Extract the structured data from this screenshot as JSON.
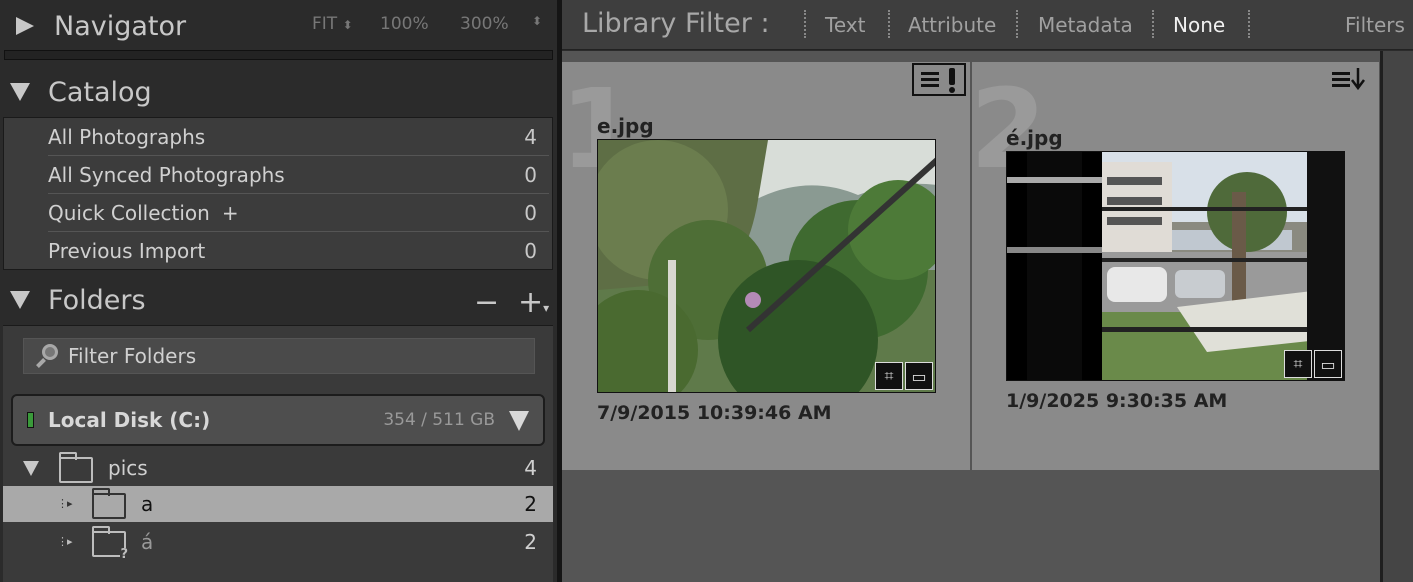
{
  "navigator": {
    "title": "Navigator",
    "zoom_options": [
      "FIT",
      "100%",
      "300%"
    ]
  },
  "catalog": {
    "title": "Catalog",
    "items": [
      {
        "label": "All Photographs",
        "count": "4"
      },
      {
        "label": "All Synced Photographs",
        "count": "0"
      },
      {
        "label": "Quick Collection",
        "suffix": "+",
        "count": "0"
      },
      {
        "label": "Previous Import",
        "count": "0"
      }
    ]
  },
  "folders": {
    "title": "Folders",
    "remove_label": "−",
    "add_label": "+",
    "filter_placeholder": "Filter Folders",
    "disk": {
      "name": "Local Disk (C:)",
      "size": "354 / 511 GB",
      "status_color": "#3a9a3a"
    },
    "tree": [
      {
        "name": "pics",
        "count": "4",
        "level": 0
      },
      {
        "name": "a",
        "count": "2",
        "level": 1,
        "selected": true
      },
      {
        "name": "á",
        "count": "2",
        "level": 1,
        "missing": true
      }
    ]
  },
  "library_filter": {
    "title": "Library Filter :",
    "options": [
      "Text",
      "Attribute",
      "Metadata",
      "None"
    ],
    "active": "None",
    "filters_label": "Filters"
  },
  "photos": [
    {
      "index": "1",
      "filename": "e.jpg",
      "date": "7/9/2015 10:39:46 AM"
    },
    {
      "index": "2",
      "filename": "é.jpg",
      "date": "1/9/2025 9:30:35 AM"
    }
  ],
  "colors": {
    "accent_selected": "#a9a9a9",
    "grid_cell": "#8a8a8a"
  }
}
